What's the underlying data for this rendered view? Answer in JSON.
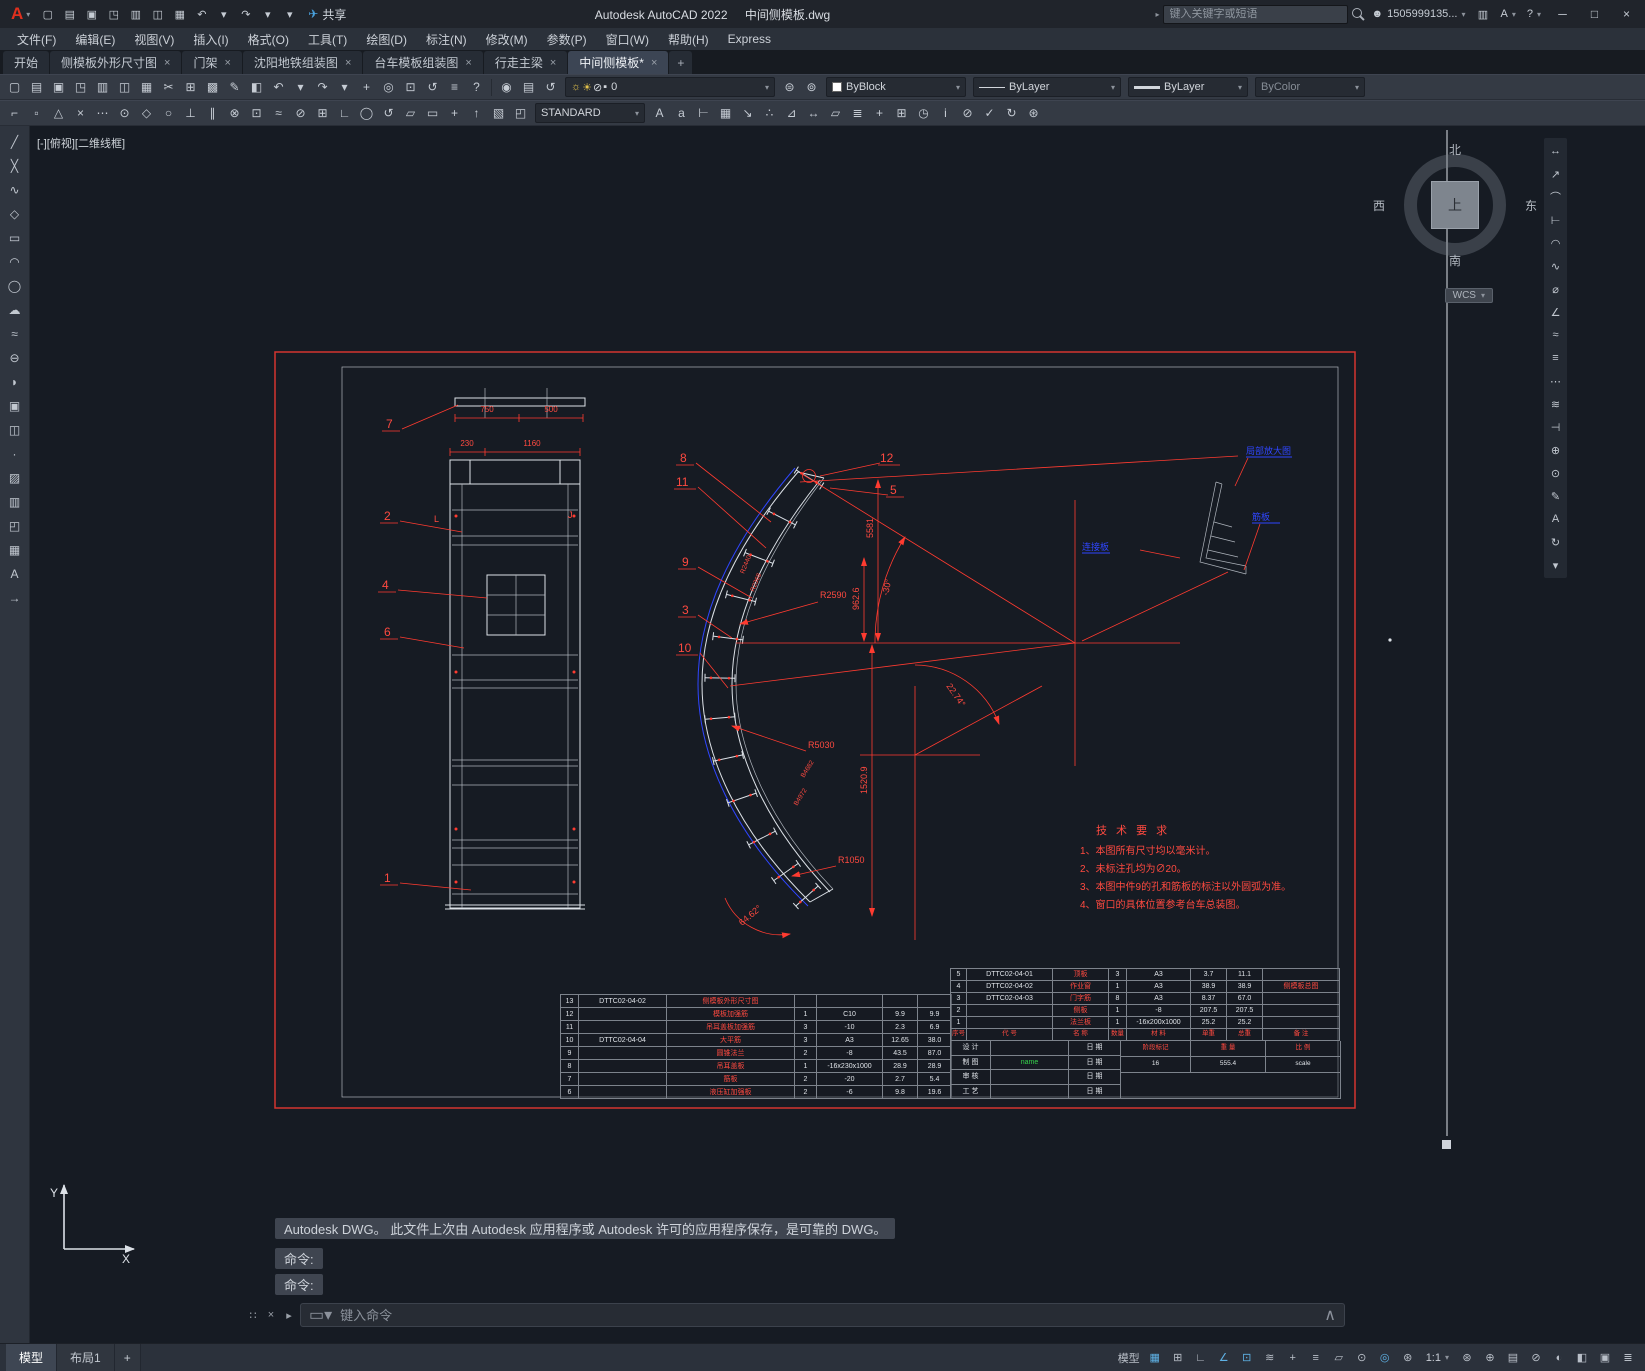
{
  "titlebar": {
    "logo_letter": "A",
    "quick": [
      {
        "n": "qnew-icon",
        "g": "▢"
      },
      {
        "n": "open-icon",
        "g": "▤"
      },
      {
        "n": "save-icon",
        "g": "▣"
      },
      {
        "n": "save-as-icon",
        "g": "◳"
      },
      {
        "n": "plot-icon",
        "g": "▥"
      },
      {
        "n": "plot-preview-icon",
        "g": "◫"
      },
      {
        "n": "publish-icon",
        "g": "▦"
      },
      {
        "n": "undo-icon",
        "g": "↶"
      },
      {
        "n": "undo-caret-icon",
        "g": "▾"
      },
      {
        "n": "redo-icon",
        "g": "↷"
      },
      {
        "n": "redo-caret-icon",
        "g": "▾"
      },
      {
        "n": "workspace-caret-icon",
        "g": "▾"
      }
    ],
    "share_label": "共享",
    "app_title": "Autodesk AutoCAD 2022",
    "doc_title": "中间侧模板.dwg",
    "search_placeholder": "键入关键字或短语",
    "user_id": "1505999135...",
    "window": {
      "min": "─",
      "max": "□",
      "close": "×"
    }
  },
  "menubar": {
    "items": [
      "文件(F)",
      "编辑(E)",
      "视图(V)",
      "插入(I)",
      "格式(O)",
      "工具(T)",
      "绘图(D)",
      "标注(N)",
      "修改(M)",
      "参数(P)",
      "窗口(W)",
      "帮助(H)",
      "Express"
    ]
  },
  "doc_tabs": {
    "items": [
      {
        "label": "开始",
        "active": false,
        "closable": false
      },
      {
        "label": "侧模板外形尺寸图",
        "active": false,
        "closable": true
      },
      {
        "label": "门架",
        "active": false,
        "closable": true
      },
      {
        "label": "沈阳地铁组装图",
        "active": false,
        "closable": true
      },
      {
        "label": "台车模板组装图",
        "active": false,
        "closable": true
      },
      {
        "label": "行走主梁",
        "active": false,
        "closable": true
      },
      {
        "label": "中间侧模板*",
        "active": true,
        "closable": true
      }
    ],
    "new_tab": "+"
  },
  "toolbars": {
    "row1a": [
      {
        "n": "new-icon",
        "g": "▢"
      },
      {
        "n": "open-icon",
        "g": "▤"
      },
      {
        "n": "save-icon",
        "g": "▣"
      },
      {
        "n": "save-as-icon",
        "g": "◳"
      },
      {
        "n": "plot-icon",
        "g": "▥"
      },
      {
        "n": "plot-preview-icon",
        "g": "◫"
      },
      {
        "n": "publish-icon",
        "g": "▦"
      },
      {
        "n": "cut-icon",
        "g": "✂"
      },
      {
        "n": "copy-icon",
        "g": "⊞"
      },
      {
        "n": "paste-icon",
        "g": "▩"
      },
      {
        "n": "match-properties-icon",
        "g": "✎"
      },
      {
        "n": "block-editor-icon",
        "g": "◧"
      },
      {
        "n": "undo-icon",
        "g": "↶"
      },
      {
        "n": "undo-caret-icon",
        "g": "▾"
      },
      {
        "n": "redo-icon",
        "g": "↷"
      },
      {
        "n": "redo-caret-icon",
        "g": "▾"
      },
      {
        "n": "pan-icon",
        "g": "+"
      },
      {
        "n": "zoom-realtime-icon",
        "g": "◎"
      },
      {
        "n": "zoom-window-icon",
        "g": "⊡"
      },
      {
        "n": "zoom-previous-icon",
        "g": "↺"
      },
      {
        "n": "properties-icon",
        "g": "≡"
      },
      {
        "n": "help-icon",
        "g": "?"
      }
    ],
    "layer_tools": [
      {
        "n": "make-layer-current-icon",
        "g": "◉"
      },
      {
        "n": "layer-properties-icon",
        "g": "▤"
      },
      {
        "n": "layer-previous-icon",
        "g": "↺"
      }
    ],
    "layer_combo": {
      "icons": [
        {
          "n": "layer-on-icon",
          "g": "☼",
          "y": true
        },
        {
          "n": "layer-freeze-icon",
          "g": "☀",
          "y": true
        },
        {
          "n": "layer-lock-icon",
          "g": "⊘",
          "y": false
        },
        {
          "n": "layer-color-swatch",
          "g": "▪",
          "y": false
        }
      ],
      "value": "0"
    },
    "after_layer": [
      {
        "n": "layer-states-icon",
        "g": "⊜"
      },
      {
        "n": "layer-isolate-icon",
        "g": "⊚"
      }
    ],
    "color_value": "ByBlock",
    "linetype_value": "ByLayer",
    "lineweight_value": "ByLayer",
    "plotstyle_value": "ByColor",
    "text_style_value": "STANDARD",
    "row2a": [
      {
        "n": "snap-from-icon",
        "g": "⌐"
      },
      {
        "n": "snap-endpoint-icon",
        "g": "▫"
      },
      {
        "n": "snap-midpoint-icon",
        "g": "△"
      },
      {
        "n": "snap-intersection-icon",
        "g": "×"
      },
      {
        "n": "snap-extension-icon",
        "g": "⋯"
      },
      {
        "n": "snap-center-icon",
        "g": "⊙"
      },
      {
        "n": "snap-quadrant-icon",
        "g": "◇"
      },
      {
        "n": "snap-tangent-icon",
        "g": "○"
      },
      {
        "n": "snap-perpendicular-icon",
        "g": "⊥"
      },
      {
        "n": "snap-parallel-icon",
        "g": "∥"
      },
      {
        "n": "snap-node-icon",
        "g": "⊗"
      },
      {
        "n": "snap-insert-icon",
        "g": "⊡"
      },
      {
        "n": "snap-nearest-icon",
        "g": "≈"
      },
      {
        "n": "snap-none-icon",
        "g": "⊘"
      },
      {
        "n": "osnap-settings-icon",
        "g": "⊞"
      },
      {
        "n": "ucs-icon",
        "g": "∟"
      },
      {
        "n": "ucs-world-icon",
        "g": "◯"
      },
      {
        "n": "ucs-previous-icon",
        "g": "↺"
      },
      {
        "n": "ucs-face-icon",
        "g": "▱"
      },
      {
        "n": "ucs-object-icon",
        "g": "▭"
      },
      {
        "n": "ucs-origin-icon",
        "g": "+"
      },
      {
        "n": "ucs-z-axis-icon",
        "g": "↑"
      },
      {
        "n": "named-views-icon",
        "g": "▧"
      },
      {
        "n": "3d-views-icon",
        "g": "◰"
      }
    ],
    "row2b": [
      {
        "n": "multiline-text-icon",
        "g": "A"
      },
      {
        "n": "single-line-text-icon",
        "g": "a"
      },
      {
        "n": "dim-style-icon",
        "g": "⊢"
      },
      {
        "n": "table-style-icon",
        "g": "▦"
      },
      {
        "n": "mleader-style-icon",
        "g": "↘"
      },
      {
        "n": "point-style-icon",
        "g": "∴"
      },
      {
        "n": "units-icon",
        "g": "⊿"
      },
      {
        "n": "distance-icon",
        "g": "↔"
      },
      {
        "n": "area-icon",
        "g": "▱"
      },
      {
        "n": "list-icon",
        "g": "≣"
      },
      {
        "n": "locate-point-icon",
        "g": "+"
      },
      {
        "n": "quick-calc-icon",
        "g": "⊞"
      },
      {
        "n": "time-icon",
        "g": "◷"
      },
      {
        "n": "status-icon",
        "g": "i"
      },
      {
        "n": "purge-icon",
        "g": "⊘"
      },
      {
        "n": "audit-icon",
        "g": "✓"
      },
      {
        "n": "recover-icon",
        "g": "↻"
      },
      {
        "n": "options-icon",
        "g": "⊛"
      }
    ]
  },
  "left_toolbar": {
    "items": [
      {
        "n": "line-tool",
        "g": "╱"
      },
      {
        "n": "construction-line-tool",
        "g": "╳"
      },
      {
        "n": "polyline-tool",
        "g": "∿"
      },
      {
        "n": "polygon-tool",
        "g": "◇"
      },
      {
        "n": "rectangle-tool",
        "g": "▭"
      },
      {
        "n": "arc-tool",
        "g": "◠"
      },
      {
        "n": "circle-tool",
        "g": "◯"
      },
      {
        "n": "revision-cloud-tool",
        "g": "☁"
      },
      {
        "n": "spline-tool",
        "g": "≈"
      },
      {
        "n": "ellipse-tool",
        "g": "⊖"
      },
      {
        "n": "ellipse-arc-tool",
        "g": "◗"
      },
      {
        "n": "insert-block-tool",
        "g": "▣"
      },
      {
        "n": "make-block-tool",
        "g": "◫"
      },
      {
        "n": "point-tool",
        "g": "·"
      },
      {
        "n": "hatch-tool",
        "g": "▨"
      },
      {
        "n": "gradient-tool",
        "g": "▥"
      },
      {
        "n": "region-tool",
        "g": "◰"
      },
      {
        "n": "table-tool",
        "g": "▦"
      },
      {
        "n": "mtext-tool",
        "g": "A"
      },
      {
        "n": "ray-tool",
        "g": "→"
      }
    ]
  },
  "navbar": {
    "items": [
      {
        "n": "linear-dimension-icon",
        "g": "↔"
      },
      {
        "n": "aligned-dimension-icon",
        "g": "↗"
      },
      {
        "n": "arc-length-icon",
        "g": "⌒"
      },
      {
        "n": "ordinate-icon",
        "g": "⊢"
      },
      {
        "n": "radius-icon",
        "g": "◠"
      },
      {
        "n": "jogged-icon",
        "g": "∿"
      },
      {
        "n": "diameter-icon",
        "g": "⌀"
      },
      {
        "n": "angular-icon",
        "g": "∠"
      },
      {
        "n": "quick-dim-icon",
        "g": "≈"
      },
      {
        "n": "baseline-icon",
        "g": "≡"
      },
      {
        "n": "continue-icon",
        "g": "⋯"
      },
      {
        "n": "dim-space-icon",
        "g": "≋"
      },
      {
        "n": "dim-break-icon",
        "g": "⊣"
      },
      {
        "n": "tolerance-icon",
        "g": "⊕"
      },
      {
        "n": "center-mark-icon",
        "g": "⊙"
      },
      {
        "n": "dim-edit-icon",
        "g": "✎"
      },
      {
        "n": "dim-text-edit-icon",
        "g": "A"
      },
      {
        "n": "dim-update-icon",
        "g": "↻"
      },
      {
        "n": "dim-style-caret-icon",
        "g": "▾"
      }
    ]
  },
  "viewcube": {
    "north": "北",
    "south": "南",
    "west": "西",
    "east": "东",
    "top": "上",
    "wcs": "WCS"
  },
  "viewport_label": "[-][俯视][二维线框]",
  "drawing": {
    "balloons": {
      "n1": "1",
      "n2": "2",
      "n3": "3",
      "n4": "4",
      "n5": "5",
      "n6": "6",
      "n7": "7",
      "n8": "8",
      "n9": "9",
      "n10": "10",
      "n11": "11",
      "n12": "12"
    },
    "dims": {
      "len5581": "5581",
      "len962": "962.6",
      "len1520": "1520.9",
      "r2590": "R2590",
      "r5030": "R5030",
      "r1050": "R1050",
      "ang30": "-30°",
      "ang2274": "22.74°",
      "ang6462": "64.62°",
      "top750": "750",
      "top500": "500",
      "w230": "230",
      "w1160": "1160",
      "lblL": "L",
      "lblJ": "J",
      "r2440": "R2440",
      "r2368": "R2368",
      "b4682": "B4682",
      "b4972": "B4972"
    },
    "notes": {
      "title": "技 术 要 求",
      "l1": "1、本图所有尺寸均以毫米计。",
      "l2": "2、未标注孔均为∅20。",
      "l3": "3、本图中件9的孔和筋板的标注以外圆弧为准。",
      "l4": "4、窗口的具体位置参考台车总装图。"
    },
    "blue": {
      "a": "局部放大图",
      "b": "筋板",
      "c": "连接板"
    },
    "table_left": {
      "rows": [
        [
          "13",
          "DTTC02-04-02",
          "侧模板外形尺寸图",
          "",
          "",
          "",
          ""
        ],
        [
          "12",
          "",
          "模板加强筋",
          "1",
          "C10",
          "9.9",
          "9.9"
        ],
        [
          "11",
          "",
          "吊耳盖板加强筋",
          "3",
          "-10",
          "2.3",
          "6.9"
        ],
        [
          "10",
          "DTTC02-04-04",
          "大平筋",
          "3",
          "A3",
          "12.65",
          "38.0"
        ],
        [
          "9",
          "",
          "圆锥法兰",
          "2",
          "-8",
          "43.5",
          "87.0"
        ],
        [
          "8",
          "",
          "吊耳盖板",
          "1",
          "-16x230x1000",
          "28.9",
          "28.9"
        ],
        [
          "7",
          "",
          "筋板",
          "2",
          "-20",
          "2.7",
          "5.4"
        ],
        [
          "6",
          "",
          "液压缸加强板",
          "2",
          "-6",
          "9.8",
          "19.6"
        ]
      ]
    },
    "table_right": {
      "rows": [
        [
          "5",
          "DTTC02-04-01",
          "顶板",
          "3",
          "A3",
          "3.7",
          "11.1",
          ""
        ],
        [
          "4",
          "DTTC02-04-02",
          "作业窗",
          "1",
          "A3",
          "38.9",
          "38.9",
          "侧模板总图"
        ],
        [
          "3",
          "DTTC02-04-03",
          "门字筋",
          "8",
          "A3",
          "8.37",
          "67.0",
          ""
        ],
        [
          "2",
          "",
          "侧板",
          "1",
          "-8",
          "207.5",
          "207.5",
          ""
        ],
        [
          "1",
          "",
          "法兰板",
          "1",
          "-16x200x1000",
          "25.2",
          "25.2",
          ""
        ]
      ],
      "header": [
        "序号",
        "代 号",
        "名 称",
        "数量",
        "材 料",
        "单重",
        "总重",
        "备 注"
      ]
    },
    "titleblock": {
      "sign_rows": [
        {
          "l": "设 计",
          "v": "",
          "d": "日 期",
          "green": false
        },
        {
          "l": "制 图",
          "v": "name",
          "d": "日 期",
          "green": true
        },
        {
          "l": "审 核",
          "v": "",
          "d": "日 期",
          "green": false
        },
        {
          "l": "工 艺",
          "v": "",
          "d": "日 期",
          "green": false
        }
      ],
      "right_header": [
        "阶段标记",
        "重 量",
        "比 例"
      ],
      "right_values": [
        "16",
        "555.4",
        "scale"
      ]
    }
  },
  "command": {
    "notice": "Autodesk DWG。  此文件上次由 Autodesk 应用程序或 Autodesk 许可的应用程序保存，是可靠的 DWG。",
    "line1": "命令:",
    "line2": "命令:",
    "input_placeholder": "键入命令"
  },
  "statusbar": {
    "model_tab": "模型",
    "layout_tab": "布局1",
    "new_layout": "+",
    "model_label": "模型",
    "scale": "1:1",
    "right1": [
      {
        "n": "grid-icon",
        "g": "▦",
        "on": true
      },
      {
        "n": "snap-mode-icon",
        "g": "⊞",
        "on": false
      },
      {
        "n": "ortho-icon",
        "g": "∟",
        "on": false
      },
      {
        "n": "polar-tracking-icon",
        "g": "∠",
        "on": true
      },
      {
        "n": "object-snap-icon",
        "g": "⊡",
        "on": true
      },
      {
        "n": "object-snap-tracking-icon",
        "g": "≋",
        "on": false
      },
      {
        "n": "dynamic-input-icon",
        "g": "+",
        "on": false
      },
      {
        "n": "lineweight-display-icon",
        "g": "≡",
        "on": false
      },
      {
        "n": "transparency-icon",
        "g": "▱",
        "on": false
      },
      {
        "n": "selection-cycling-icon",
        "g": "⊙",
        "on": false
      },
      {
        "n": "annotation-visibility-icon",
        "g": "◎",
        "on": true
      },
      {
        "n": "autoscale-icon",
        "g": "⊛",
        "on": false
      }
    ],
    "right2": [
      {
        "n": "workspace-gear-icon",
        "g": "⊛",
        "on": false
      },
      {
        "n": "annotation-monitor-icon",
        "g": "⊕",
        "on": false
      },
      {
        "n": "quick-properties-icon",
        "g": "▤",
        "on": false
      },
      {
        "n": "lock-ui-icon",
        "g": "⊘",
        "on": false
      },
      {
        "n": "isolate-objects-icon",
        "g": "◐",
        "on": false
      },
      {
        "n": "graphics-performance-icon",
        "g": "◧",
        "on": false
      },
      {
        "n": "clean-screen-icon",
        "g": "▣",
        "on": false
      },
      {
        "n": "customization-menu-icon",
        "g": "≣",
        "on": false
      }
    ]
  }
}
